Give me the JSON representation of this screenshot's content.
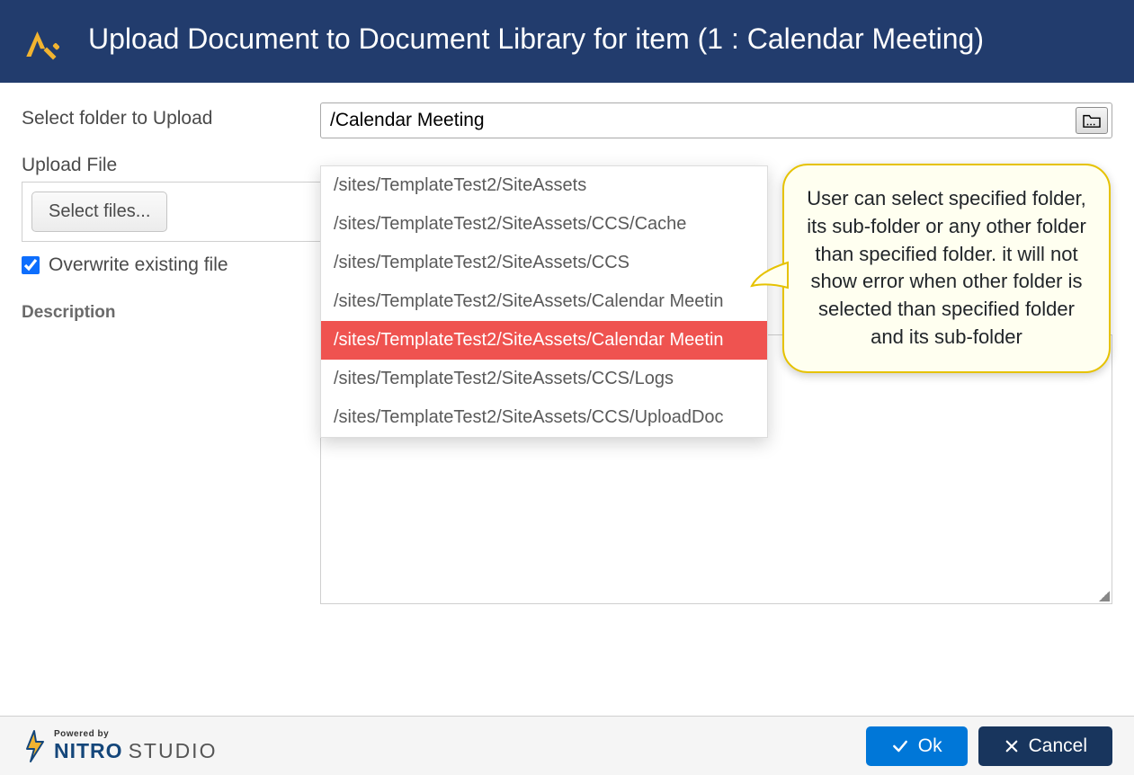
{
  "header": {
    "title": "Upload Document to Document Library for item (1 : Calendar Meeting)"
  },
  "form": {
    "folder_label": "Select folder to Upload",
    "folder_value": "/Calendar Meeting",
    "upload_label": "Upload File",
    "select_files_label": "Select files...",
    "overwrite_label": "Overwrite existing file",
    "overwrite_checked": true,
    "description_label": "Description"
  },
  "dropdown": {
    "options": [
      "/sites/TemplateTest2/SiteAssets",
      "/sites/TemplateTest2/SiteAssets/CCS/Cache",
      "/sites/TemplateTest2/SiteAssets/CCS",
      "/sites/TemplateTest2/SiteAssets/Calendar Meetin",
      "/sites/TemplateTest2/SiteAssets/Calendar Meetin",
      "/sites/TemplateTest2/SiteAssets/CCS/Logs",
      "/sites/TemplateTest2/SiteAssets/CCS/UploadDoc"
    ],
    "selected_index": 4
  },
  "callout": {
    "text": "User can select specified folder, its sub-folder or any other folder than specified folder. it will not show error when other folder is selected than specified folder and its sub-folder"
  },
  "footer": {
    "powered_by": "Powered by",
    "brand1": "NITRO",
    "brand2": "STUDIO",
    "ok_label": "Ok",
    "cancel_label": "Cancel"
  }
}
